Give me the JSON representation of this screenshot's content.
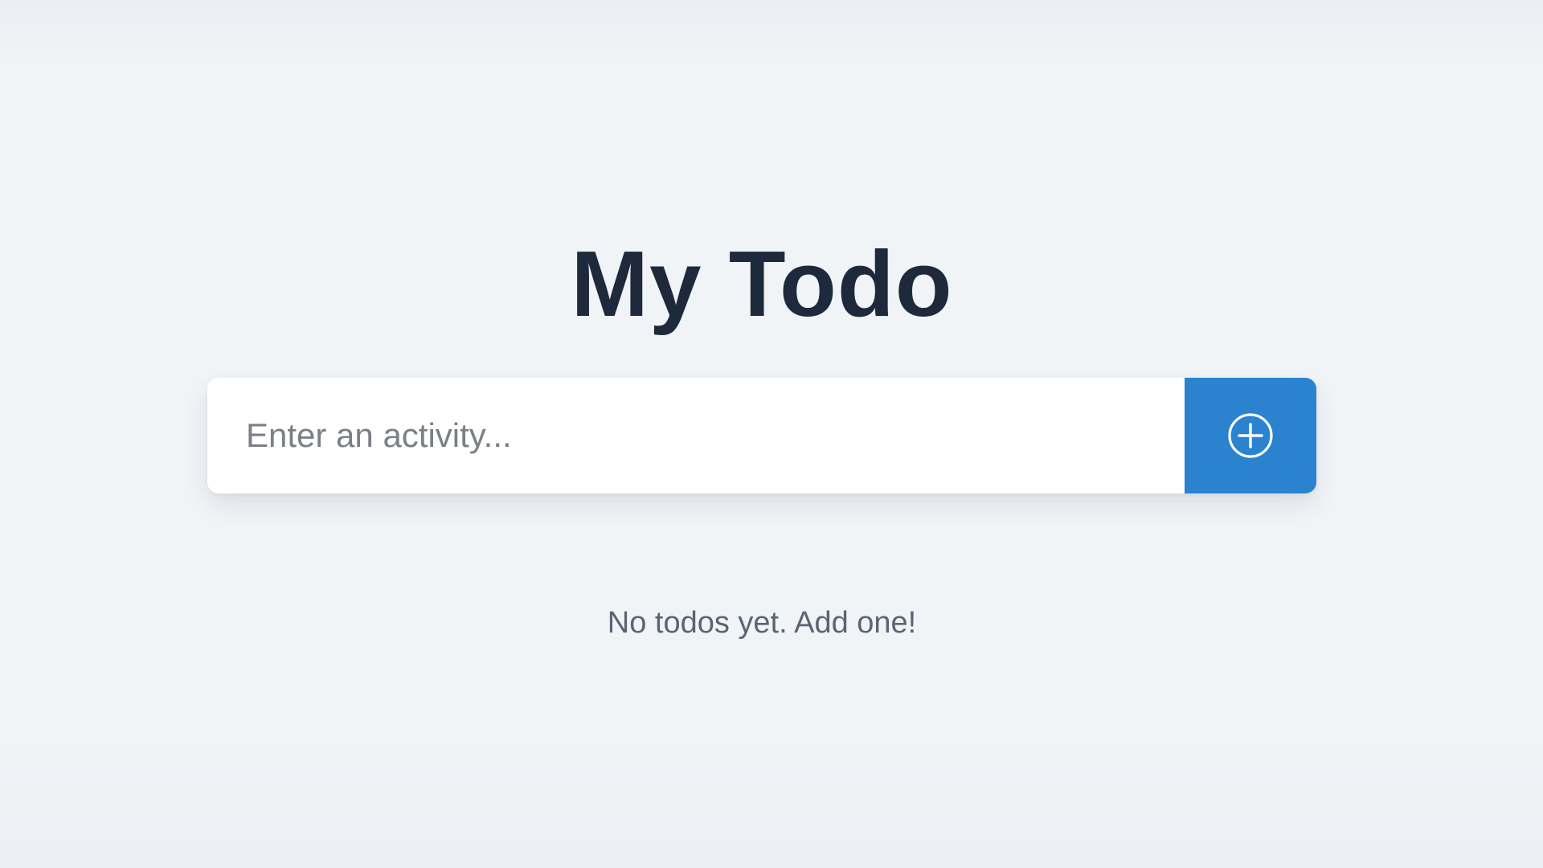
{
  "app": {
    "title": "My Todo"
  },
  "todo_input": {
    "placeholder": "Enter an activity...",
    "value": ""
  },
  "add_button": {
    "icon": "plus-circle-icon",
    "color": "#2b82cf"
  },
  "todo_list": {
    "items": [],
    "empty_message": "No todos yet. Add one!"
  },
  "colors": {
    "background": "#f1f4f7",
    "title": "#1e293b",
    "accent": "#2b82cf",
    "muted_text": "#5b6473"
  }
}
